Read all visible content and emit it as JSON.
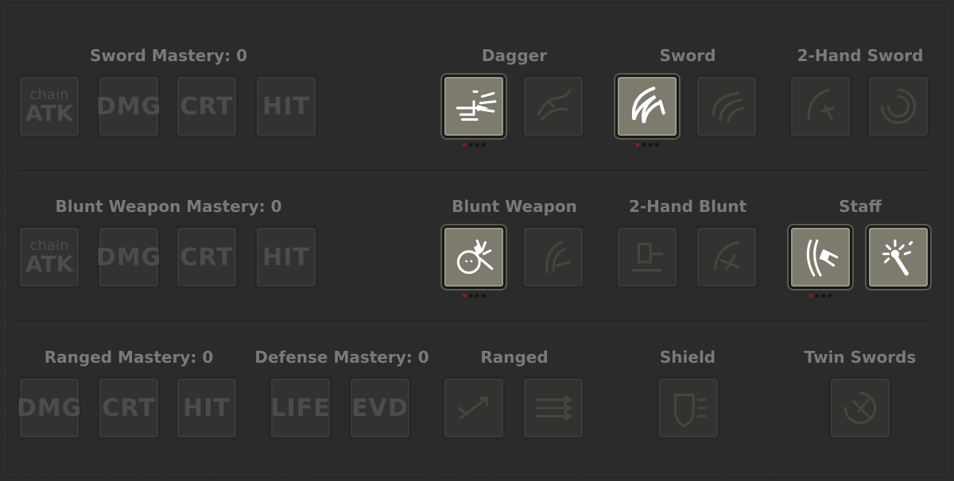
{
  "colors": {
    "background": "#2a2b2a",
    "label": "#7a7b78",
    "tile_inactive": "#323331",
    "tile_active": "#7c7b6e",
    "dot_active": "#8a1e14"
  },
  "row1": {
    "sword_mastery": {
      "label": "Sword Mastery: 0",
      "tiles": [
        "DMG",
        "CRT",
        "HIT"
      ],
      "chain_top": "chain",
      "chain_bottom": "ATK"
    },
    "dagger": {
      "label": "Dagger",
      "skills": [
        "dagger-throw-icon",
        "dagger-dragon-icon"
      ],
      "rank": "1/4"
    },
    "sword": {
      "label": "Sword",
      "skills": [
        "sword-slash-icon",
        "sword-wave-icon"
      ],
      "rank": "1/4"
    },
    "two_hand_sword": {
      "label": "2-Hand Sword",
      "skills": [
        "greatsword-swing-icon",
        "greatsword-spin-icon"
      ]
    }
  },
  "row2": {
    "blunt_mastery": {
      "label": "Blunt Weapon Mastery: 0",
      "tiles": [
        "DMG",
        "CRT",
        "HIT"
      ],
      "chain_top": "chain",
      "chain_bottom": "ATK"
    },
    "blunt_weapon": {
      "label": "Blunt Weapon",
      "skills": [
        "blunt-stun-icon",
        "blunt-swing-icon"
      ],
      "rank": "1/4"
    },
    "two_hand_blunt": {
      "label": "2-Hand Blunt",
      "skills": [
        "hammer-slam-icon",
        "hammer-swing-icon"
      ]
    },
    "staff": {
      "label": "Staff",
      "skills": [
        "staff-strike-icon",
        "staff-magic-icon"
      ],
      "rank": "1/4"
    }
  },
  "row3": {
    "ranged_mastery": {
      "label": "Ranged Mastery: 0",
      "tiles": [
        "DMG",
        "CRT",
        "HIT"
      ]
    },
    "defense_mastery": {
      "label": "Defense Mastery: 0",
      "tiles": [
        "LIFE",
        "EVD"
      ]
    },
    "ranged": {
      "label": "Ranged",
      "skills": [
        "arrow-shot-icon",
        "arrow-volley-icon"
      ]
    },
    "shield": {
      "label": "Shield",
      "skills": [
        "shield-block-icon"
      ]
    },
    "twin_swords": {
      "label": "Twin Swords",
      "skills": [
        "twin-swords-icon"
      ]
    }
  }
}
